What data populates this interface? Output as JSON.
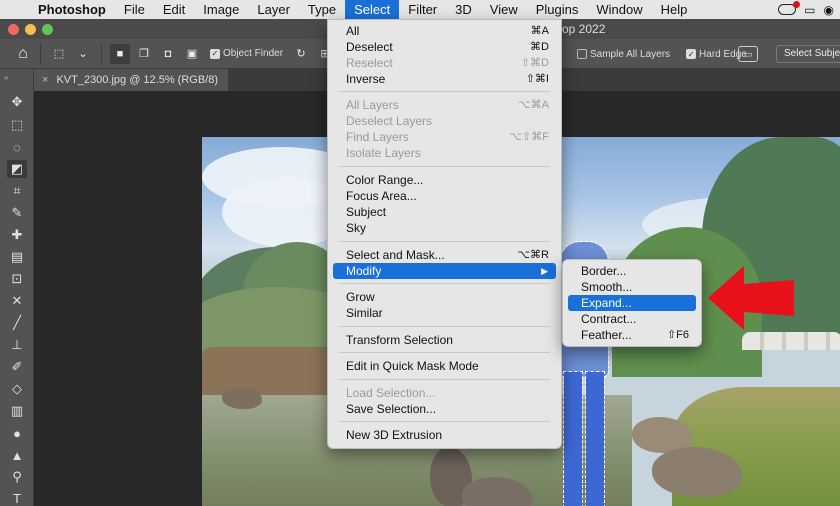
{
  "menubar": {
    "app_name": "Photoshop",
    "items": [
      {
        "label": "File"
      },
      {
        "label": "Edit"
      },
      {
        "label": "Image"
      },
      {
        "label": "Layer"
      },
      {
        "label": "Type"
      },
      {
        "label": "Select"
      },
      {
        "label": "Filter"
      },
      {
        "label": "3D"
      },
      {
        "label": "View"
      },
      {
        "label": "Plugins"
      },
      {
        "label": "Window"
      },
      {
        "label": "Help"
      }
    ],
    "active_item": "Select"
  },
  "window": {
    "title_suffix": "op 2022"
  },
  "options_bar": {
    "object_finder_label": "Object Finder",
    "sample_all_layers_label": "Sample All Layers",
    "hard_edge_label": "Hard Edge",
    "select_subject_label": "Select Subjec"
  },
  "document_tab": {
    "label": "KVT_2300.jpg @ 12.5% (RGB/8)",
    "close": "×"
  },
  "select_menu": {
    "items": [
      {
        "label": "All",
        "shortcut": "⌘A"
      },
      {
        "label": "Deselect",
        "shortcut": "⌘D"
      },
      {
        "label": "Reselect",
        "shortcut": "⇧⌘D"
      },
      {
        "label": "Inverse",
        "shortcut": "⇧⌘I"
      },
      {
        "label": "All Layers",
        "shortcut": "⌥⌘A"
      },
      {
        "label": "Deselect Layers",
        "shortcut": ""
      },
      {
        "label": "Find Layers",
        "shortcut": "⌥⇧⌘F"
      },
      {
        "label": "Isolate Layers",
        "shortcut": ""
      },
      {
        "label": "Color Range...",
        "shortcut": ""
      },
      {
        "label": "Focus Area...",
        "shortcut": ""
      },
      {
        "label": "Subject",
        "shortcut": ""
      },
      {
        "label": "Sky",
        "shortcut": ""
      },
      {
        "label": "Select and Mask...",
        "shortcut": "⌥⌘R"
      },
      {
        "label": "Modify",
        "shortcut": ""
      },
      {
        "label": "Grow",
        "shortcut": ""
      },
      {
        "label": "Similar",
        "shortcut": ""
      },
      {
        "label": "Transform Selection",
        "shortcut": ""
      },
      {
        "label": "Edit in Quick Mask Mode",
        "shortcut": ""
      },
      {
        "label": "Load Selection...",
        "shortcut": ""
      },
      {
        "label": "Save Selection...",
        "shortcut": ""
      },
      {
        "label": "New 3D Extrusion",
        "shortcut": ""
      }
    ]
  },
  "modify_submenu": {
    "items": [
      {
        "label": "Border..."
      },
      {
        "label": "Smooth..."
      },
      {
        "label": "Expand..."
      },
      {
        "label": "Contract..."
      },
      {
        "label": "Feather...",
        "shortcut": "⇧F6"
      }
    ]
  },
  "colors": {
    "highlight": "#1a6fd9",
    "annotation_arrow": "#e8101a",
    "panel": "#535353"
  }
}
